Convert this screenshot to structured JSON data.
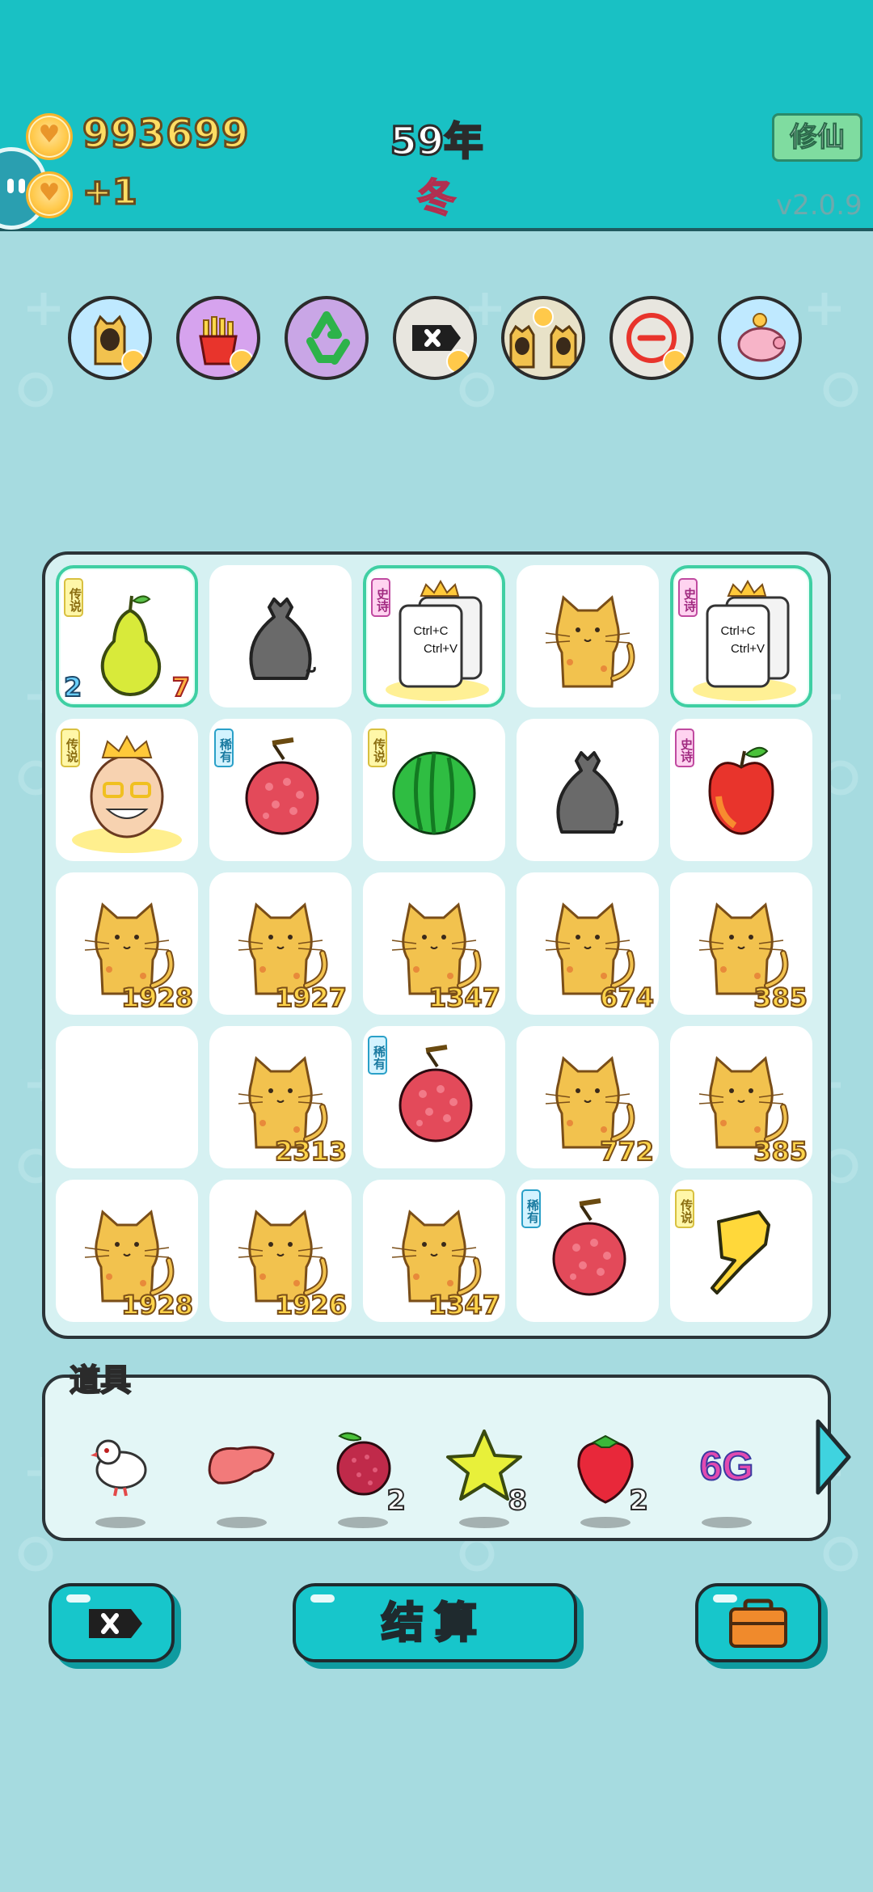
{
  "header": {
    "money": "993699",
    "income": "+1",
    "year": "59年",
    "season": "冬",
    "xiuxian_label": "修仙",
    "version": "v2.0.9"
  },
  "skills": [
    {
      "name": "cat-ghost-skill",
      "bg": "#bfe9ff"
    },
    {
      "name": "fries-skill",
      "bg": "#d6a3ee"
    },
    {
      "name": "recycle-skill",
      "bg": "#c9a6e6"
    },
    {
      "name": "delete-skill",
      "bg": "#e8e6df"
    },
    {
      "name": "double-cat-skill",
      "bg": "#e8e2c8"
    },
    {
      "name": "minus-skill",
      "bg": "#e8e6df"
    },
    {
      "name": "piggy-bank-skill",
      "bg": "#bfe9ff"
    }
  ],
  "board": {
    "rows": [
      [
        {
          "item": "pear",
          "tag": "传说",
          "tag_type": "legend",
          "selected": true,
          "left_num": "2",
          "num": "7"
        },
        {
          "item": "trash-bag"
        },
        {
          "item": "ctrl-cv-king",
          "tag": "史诗",
          "tag_type": "epic",
          "selected": true,
          "label1": "Ctrl+C",
          "label2": "Ctrl+V"
        },
        {
          "item": "cat"
        },
        {
          "item": "ctrl-cv-king",
          "tag": "史诗",
          "tag_type": "epic",
          "selected": true,
          "label1": "Ctrl+C",
          "label2": "Ctrl+V"
        }
      ],
      [
        {
          "item": "old-king",
          "tag": "传说",
          "tag_type": "legend"
        },
        {
          "item": "lychee",
          "tag": "稀有",
          "tag_type": "rare"
        },
        {
          "item": "watermelon",
          "tag": "传说",
          "tag_type": "legend"
        },
        {
          "item": "trash-bag"
        },
        {
          "item": "apple",
          "tag": "史诗",
          "tag_type": "epic"
        }
      ],
      [
        {
          "item": "cat",
          "num": "1928"
        },
        {
          "item": "cat",
          "num": "1927"
        },
        {
          "item": "cat",
          "num": "1347"
        },
        {
          "item": "cat",
          "num": "674"
        },
        {
          "item": "cat",
          "num": "385"
        }
      ],
      [
        {
          "item": "empty"
        },
        {
          "item": "cat",
          "num": "2313"
        },
        {
          "item": "lychee",
          "tag": "稀有",
          "tag_type": "rare"
        },
        {
          "item": "cat",
          "num": "772"
        },
        {
          "item": "cat",
          "num": "385"
        }
      ],
      [
        {
          "item": "cat",
          "num": "1928"
        },
        {
          "item": "cat",
          "num": "1926"
        },
        {
          "item": "cat",
          "num": "1347"
        },
        {
          "item": "lychee",
          "tag": "稀有",
          "tag_type": "rare"
        },
        {
          "item": "pointing-hand",
          "tag": "传说",
          "tag_type": "legend"
        }
      ]
    ]
  },
  "items_panel": {
    "title": "道具",
    "items": [
      {
        "name": "dove",
        "count": ""
      },
      {
        "name": "liver",
        "count": ""
      },
      {
        "name": "bayberry",
        "count": "2"
      },
      {
        "name": "star",
        "count": "8"
      },
      {
        "name": "strawberry",
        "count": "2"
      },
      {
        "name": "6g",
        "label": "6G",
        "count": ""
      }
    ]
  },
  "buttons": {
    "settle_label": "结算"
  },
  "colors": {
    "header": "#19c1c4",
    "background": "#a6dbe0",
    "button": "#17c6cb"
  }
}
